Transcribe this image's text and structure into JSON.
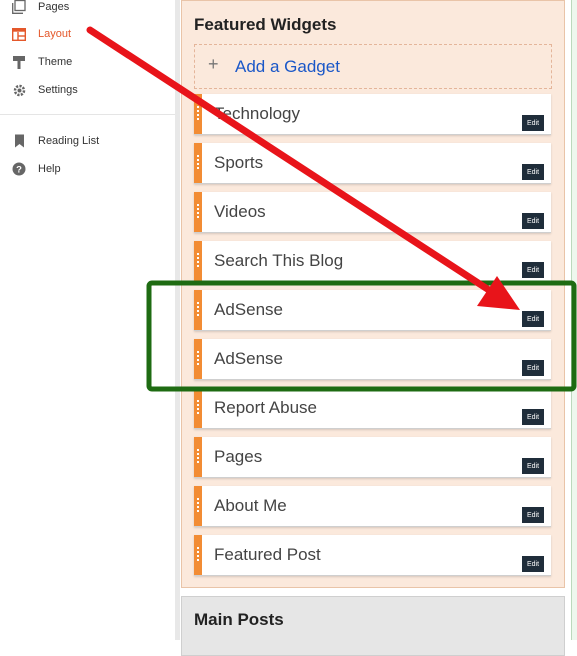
{
  "sidebar": {
    "items": [
      {
        "label": "Pages",
        "icon": "pages-icon"
      },
      {
        "label": "Layout",
        "icon": "layout-icon",
        "active": true
      },
      {
        "label": "Theme",
        "icon": "theme-icon"
      },
      {
        "label": "Settings",
        "icon": "settings-icon"
      },
      {
        "label": "Reading List",
        "icon": "bookmark-icon"
      },
      {
        "label": "Help",
        "icon": "help-icon"
      }
    ]
  },
  "featured": {
    "title": "Featured Widgets",
    "add_gadget": "Add a Gadget",
    "widgets": [
      {
        "name": "Technology",
        "edit": "Edit"
      },
      {
        "name": "Sports",
        "edit": "Edit"
      },
      {
        "name": "Videos",
        "edit": "Edit"
      },
      {
        "name": "Search This Blog",
        "edit": "Edit"
      },
      {
        "name": "AdSense",
        "edit": "Edit"
      },
      {
        "name": "AdSense",
        "edit": "Edit"
      },
      {
        "name": "Report Abuse",
        "edit": "Edit"
      },
      {
        "name": "Pages",
        "edit": "Edit"
      },
      {
        "name": "About Me",
        "edit": "Edit"
      },
      {
        "name": "Featured Post",
        "edit": "Edit"
      }
    ]
  },
  "main_posts": {
    "title": "Main Posts"
  },
  "colors": {
    "accent": "#e4582b",
    "handle": "#f28c34",
    "section_bg": "#fbe9dc",
    "link": "#1a57c8",
    "arrow": "#e8141a",
    "highlight_box": "#1e6b12",
    "edit_button": "#1f2d3a"
  }
}
